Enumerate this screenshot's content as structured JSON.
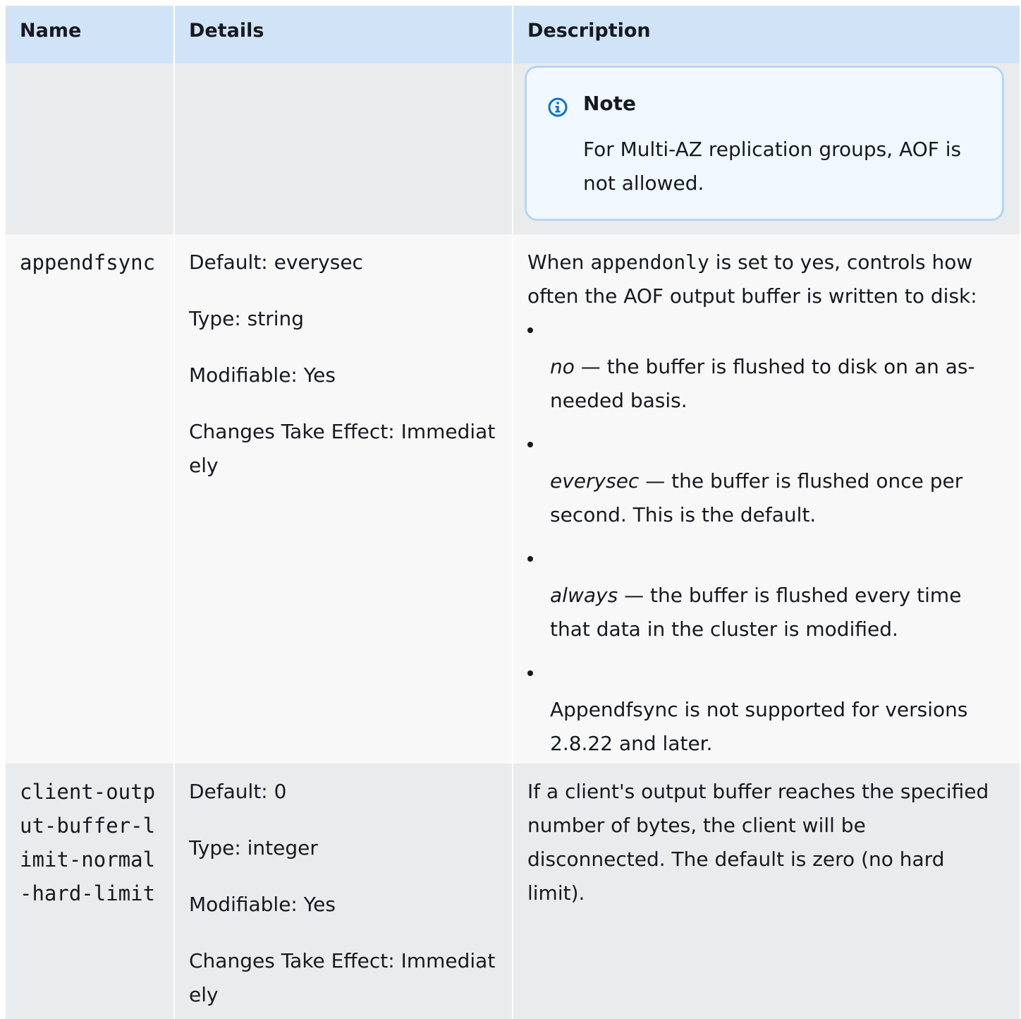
{
  "header": {
    "name": "Name",
    "details": "Details",
    "description": "Description"
  },
  "note": {
    "title": "Note",
    "body": "For Multi-AZ replication groups, AOF is not allowed.",
    "icon": "info-icon",
    "accent": "#0972d3"
  },
  "rows": [
    {
      "name": "appendfsync",
      "default": "Default: everysec",
      "type": "Type: string",
      "modifiable": "Modifiable: Yes",
      "changes": "Changes Take Effect: Immediately",
      "description_pre": "When",
      "description_code": "appendonly",
      "description_post": "is set to yes, controls how often the AOF output buffer is written to disk:",
      "options": [
        {
          "term": "no",
          "text": "— the buffer is flushed to disk on an as-needed basis."
        },
        {
          "term": "everysec",
          "text": "— the buffer is flushed once per second. This is the default."
        },
        {
          "term": "always",
          "text": "— the buffer is flushed every time that data in the cluster is modified."
        },
        {
          "term": "",
          "text": "Appendfsync is not supported for versions 2.8.22 and later."
        }
      ]
    },
    {
      "name": "client-output-buffer-limit-normal-hard-limit",
      "default": "Default: 0",
      "type": "Type: integer",
      "modifiable": "Modifiable: Yes",
      "changes": "Changes Take Effect: Immediately",
      "description": "If a client's output buffer reaches the specified number of bytes, the client will be disconnected. The default is zero (no hard limit)."
    }
  ]
}
